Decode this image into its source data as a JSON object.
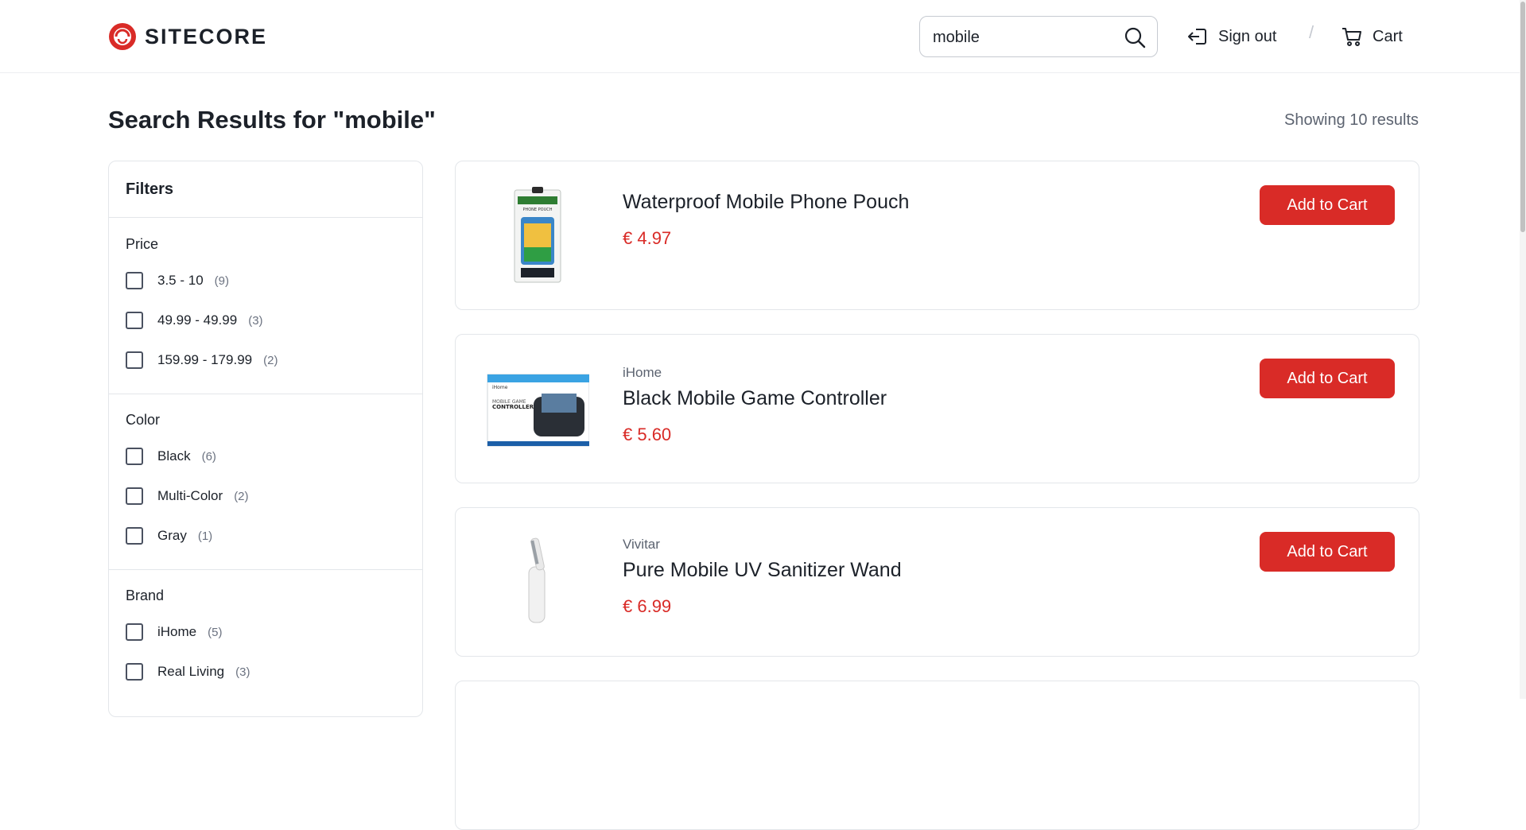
{
  "header": {
    "logo_text": "SITECORE",
    "search_value": "mobile",
    "sign_out": "Sign out",
    "divider": "/",
    "cart": "Cart"
  },
  "page": {
    "title": "Search Results for \"mobile\"",
    "results_count": "Showing 10 results"
  },
  "filters": {
    "title": "Filters",
    "groups": [
      {
        "title": "Price",
        "options": [
          {
            "label": "3.5 - 10",
            "count": "(9)"
          },
          {
            "label": "49.99 - 49.99",
            "count": "(3)"
          },
          {
            "label": "159.99 - 179.99",
            "count": "(2)"
          }
        ]
      },
      {
        "title": "Color",
        "options": [
          {
            "label": "Black",
            "count": "(6)"
          },
          {
            "label": "Multi-Color",
            "count": "(2)"
          },
          {
            "label": "Gray",
            "count": "(1)"
          }
        ]
      },
      {
        "title": "Brand",
        "options": [
          {
            "label": "iHome",
            "count": "(5)"
          },
          {
            "label": "Real Living",
            "count": "(3)"
          }
        ]
      }
    ]
  },
  "products": [
    {
      "brand": "",
      "name": "Waterproof Mobile Phone Pouch",
      "price": "€ 4.97",
      "button": "Add to Cart",
      "image_icon": "phone-pouch-image"
    },
    {
      "brand": "iHome",
      "name": "Black Mobile Game Controller",
      "price": "€ 5.60",
      "button": "Add to Cart",
      "image_icon": "game-controller-image"
    },
    {
      "brand": "Vivitar",
      "name": "Pure Mobile UV Sanitizer Wand",
      "price": "€ 6.99",
      "button": "Add to Cart",
      "image_icon": "sanitizer-wand-image"
    }
  ],
  "thumbnail_text": {
    "pouch_label": "PHONE POUCH",
    "controller_brand": "iHome",
    "controller_label_1": "MOBILE GAME",
    "controller_label_2": "CONTROLLER"
  },
  "colors": {
    "accent": "#d92b27",
    "text": "#1c2129",
    "muted": "#5c6370",
    "border": "#e3e6ea"
  }
}
